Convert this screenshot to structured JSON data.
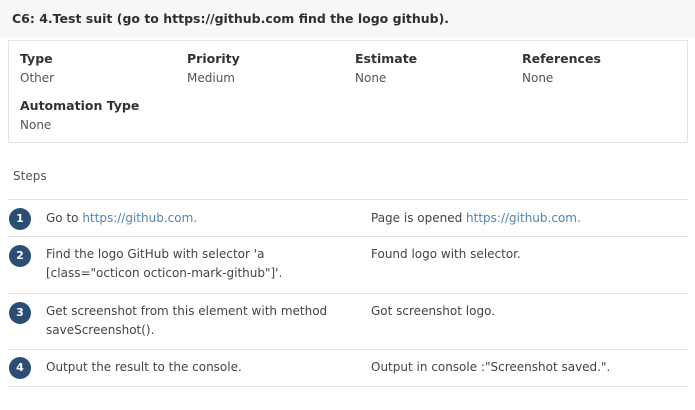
{
  "case": {
    "title": "C6: 4.Test suit (go to https://github.com find the logo github)."
  },
  "fields": {
    "type": {
      "label": "Type",
      "value": "Other"
    },
    "priority": {
      "label": "Priority",
      "value": "Medium"
    },
    "estimate": {
      "label": "Estimate",
      "value": "None"
    },
    "references": {
      "label": "References",
      "value": "None"
    },
    "automation_type": {
      "label": "Automation Type",
      "value": "None"
    }
  },
  "steps_heading": "Steps",
  "steps": [
    {
      "number": "1",
      "content_text": "Go to ",
      "content_link": "https://github.com.",
      "expected_text": "Page is opened ",
      "expected_link": "https://github.com."
    },
    {
      "number": "2",
      "content_line1": "Find the logo GitHub with selector 'a",
      "content_line2": "[class=\"octicon octicon-mark-github\"]'.",
      "expected": "Found logo with selector."
    },
    {
      "number": "3",
      "content_line1": "Get screenshot from this element with method",
      "content_line2": "saveScreenshot().",
      "expected": "Got screenshot logo."
    },
    {
      "number": "4",
      "content": "Output the result to the console.",
      "expected": "Output in console :\"Screenshot saved.\"."
    }
  ],
  "colors": {
    "step_badge": "#2a4e73",
    "link": "#4f86b5",
    "border": "#e2e2e2"
  }
}
